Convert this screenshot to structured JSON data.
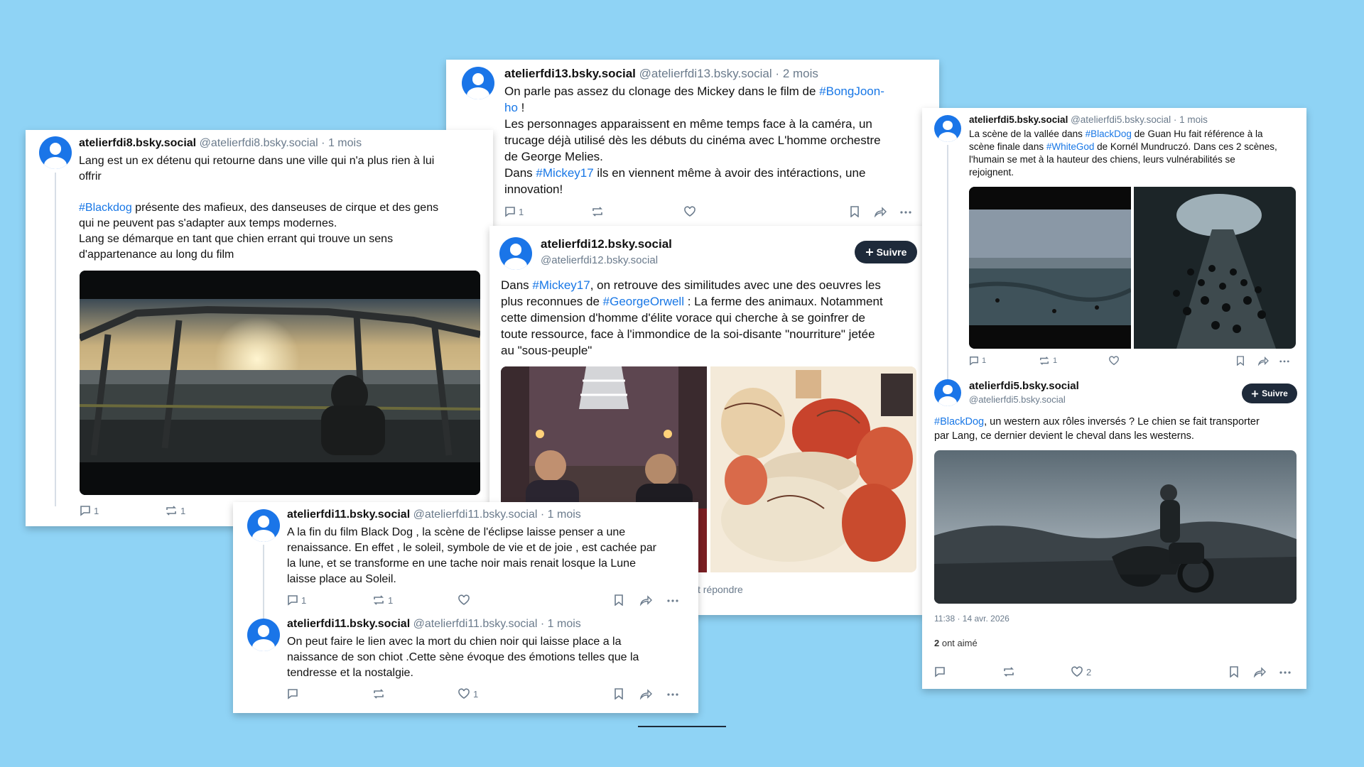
{
  "bg_color": "#8fd3f5",
  "accent": "#1877e6",
  "posts": {
    "p13": {
      "name": "atelierfdi13.bsky.social",
      "handle": "@atelierfdi13.bsky.social",
      "dot": "·",
      "time": "2 mois",
      "l1a": "On parle pas assez du clonage des Mickey dans le film de ",
      "l1tag": "#BongJoon-",
      "l2tag": "ho",
      "l2b": " !",
      "l3": "Les personnages apparaissent en même temps face à la caméra, un",
      "l4": "trucage déjà utilisé dès les débuts du cinéma avec L'homme orchestre",
      "l5": "de George Melies.",
      "l6a": "Dans ",
      "l6tag": "#Mickey17",
      "l6b": " ils en viennent même à avoir des intéractions, une",
      "l7": "innovation!",
      "replies": "1"
    },
    "p8": {
      "name": "atelierfdi8.bsky.social",
      "handle": "@atelierfdi8.bsky.social",
      "dot": "·",
      "time": "1 mois",
      "l1": "Lang est un ex détenu qui retourne dans une ville qui n'a plus rien à lui",
      "l2": "offrir",
      "l3tag": "#Blackdog",
      "l3b": " présente des mafieux, des danseuses de cirque et des gens",
      "l4": "qui ne peuvent pas s'adapter aux temps modernes.",
      "l5": "Lang se démarque en tant que chien errant qui trouve un sens",
      "l6": "d'appartenance au long du film",
      "replies": "1",
      "reposts": "1"
    },
    "p12": {
      "name": "atelierfdi12.bsky.social",
      "handle": "@atelierfdi12.bsky.social",
      "follow": "Suivre",
      "l1a": "Dans ",
      "l1tag": "#Mickey17",
      "l1b": ", on retrouve des similitudes avec une des oeuvres les",
      "l2a": "plus reconnues de ",
      "l2tag": "#GeorgeOrwell",
      "l2b": " : La ferme des animaux. Notamment",
      "l3": "cette dimension d'homme d'élite vorace qui cherche à se goinfrer de",
      "l4": "toute ressource, face à l'immondice de la soi-disante \"nourriture\" jetée",
      "l5": "au \"sous-peuple\"",
      "reply_hint": "t répondre"
    },
    "p11a": {
      "name": "atelierfdi11.bsky.social",
      "handle": "@atelierfdi11.bsky.social",
      "dot": "·",
      "time": "1 mois",
      "l1": "A la fin du film Black Dog , la scène de l'éclipse laisse penser a une",
      "l2": "renaissance. En effet , le soleil, symbole de vie et de joie , est cachée par",
      "l3": "la lune, et se transforme en une tache noir mais renait losque la Lune",
      "l4": "laisse place au Soleil.",
      "replies": "1",
      "reposts": "1"
    },
    "p11b": {
      "name": "atelierfdi11.bsky.social",
      "handle": "@atelierfdi11.bsky.social",
      "dot": "·",
      "time": "1 mois",
      "l1": "On peut faire le lien avec la mort du chien noir qui laisse place a la",
      "l2": "naissance de son chiot .Cette sène évoque des émotions telles que la",
      "l3": "tendresse et la nostalgie.",
      "likes": "1"
    },
    "p5a": {
      "name": "atelierfdi5.bsky.social",
      "handle": "@atelierfdi5.bsky.social",
      "dot": "·",
      "time": "1 mois",
      "l1a": "La scène de la vallée dans ",
      "l1tag": "#BlackDog",
      "l1b": " de Guan Hu fait référence à la",
      "l2a": "scène finale dans ",
      "l2tag": "#WhiteGod",
      "l2b": " de Kornél Mundruczó. Dans ces 2 scènes,",
      "l3": "l'humain se met à la hauteur des chiens, leurs vulnérabilités se",
      "l4": "rejoignent.",
      "replies": "1",
      "reposts": "1"
    },
    "p5b": {
      "name": "atelierfdi5.bsky.social",
      "handle": "@atelierfdi5.bsky.social",
      "follow": "Suivre",
      "l1tag": "#BlackDog",
      "l1b": ", un western aux rôles inversés ? Le chien se fait transporter",
      "l2": "par Lang, ce dernier devient le cheval dans les westerns.",
      "timestamp": "11:38 · 14 avr. 2026",
      "likes_count": "2",
      "likes_label": " ont aimé",
      "likes": "2"
    }
  },
  "icons": [
    "reply-icon",
    "repost-icon",
    "like-icon",
    "bookmark-icon",
    "share-icon",
    "more-icon",
    "plus-icon",
    "avatar-icon"
  ]
}
